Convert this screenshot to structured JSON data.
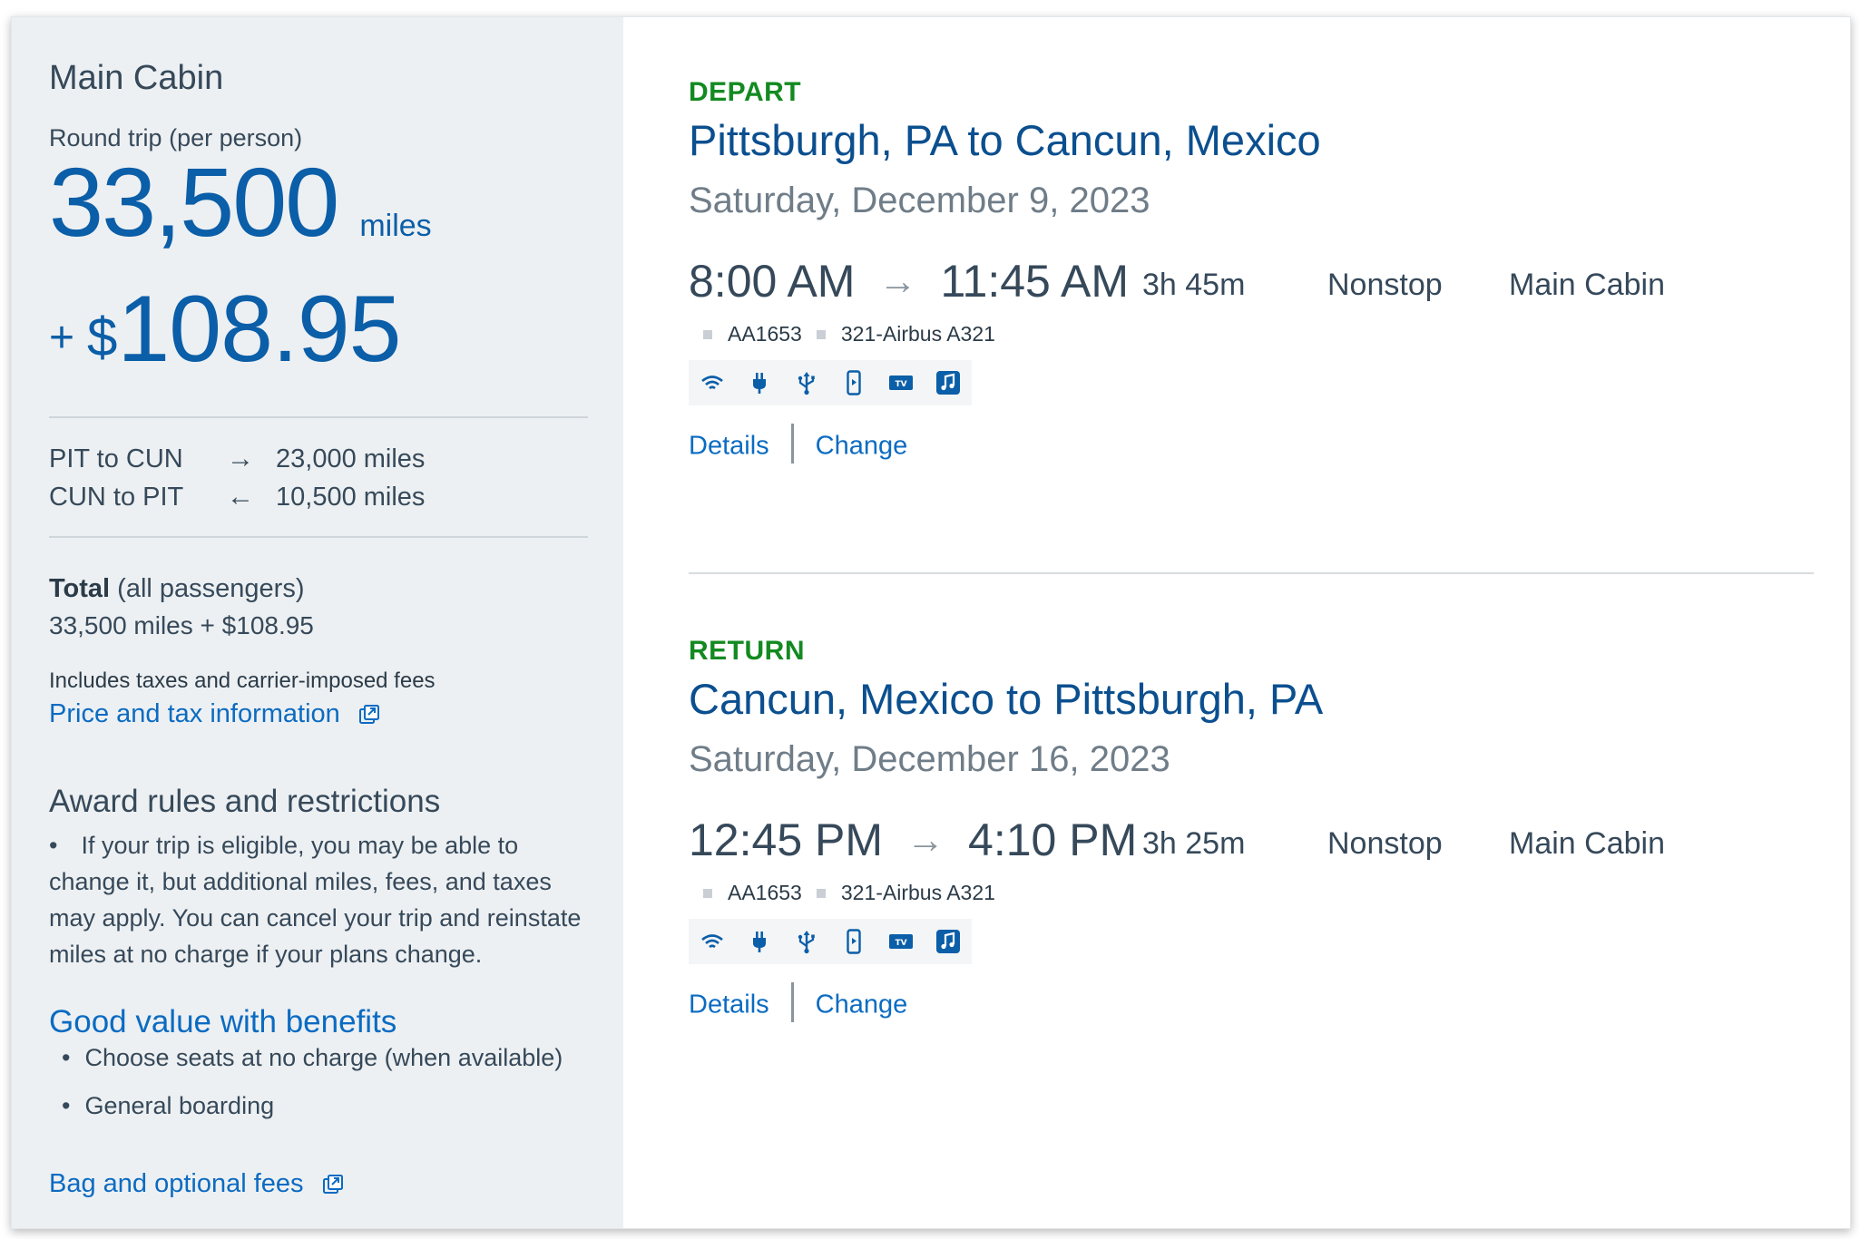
{
  "summary": {
    "cabin": "Main Cabin",
    "trip_type": "Round trip (per person)",
    "miles": "33,500",
    "miles_unit": "miles",
    "plus": "+",
    "currency": "$",
    "cash": "108.95",
    "segments": [
      {
        "route": "PIT to CUN",
        "arrow": "→",
        "miles": "23,000 miles"
      },
      {
        "route": "CUN to PIT",
        "arrow": "←",
        "miles": "10,500 miles"
      }
    ],
    "total_label": "Total",
    "total_sub": " (all passengers)",
    "total_value": "33,500 miles + $108.95",
    "tax_note": "Includes taxes and carrier-imposed fees",
    "tax_link": "Price and tax information",
    "rules_title": "Award rules and restrictions",
    "rules_bullet": "•",
    "rules_text": "If your trip is eligible, you may be able to change it, but additional miles, fees, and taxes may apply. You can cancel your trip and reinstate miles at no charge if your plans change.",
    "benefits_title": "Good value with benefits",
    "benefits": [
      "Choose seats at no charge (when available)",
      "General boarding"
    ],
    "bag_link": "Bag and optional fees"
  },
  "flights": [
    {
      "label": "DEPART",
      "route": "Pittsburgh, PA to Cancun, Mexico",
      "date": "Saturday, December 9, 2023",
      "depart": "8:00 AM",
      "arrow": "→",
      "arrive": "11:45 AM",
      "duration": "3h 45m",
      "stops": "Nonstop",
      "cabin": "Main Cabin",
      "flight_no": "AA1653",
      "aircraft": "321-Airbus A321",
      "amenities": [
        "wifi-icon",
        "power-outlet-icon",
        "usb-icon",
        "mobile-entertainment-icon",
        "tv-icon",
        "music-icon"
      ],
      "details": "Details",
      "change": "Change"
    },
    {
      "label": "RETURN",
      "route": "Cancun, Mexico to Pittsburgh, PA",
      "date": "Saturday, December 16, 2023",
      "depart": "12:45 PM",
      "arrow": "→",
      "arrive": "4:10 PM",
      "duration": "3h 25m",
      "stops": "Nonstop",
      "cabin": "Main Cabin",
      "flight_no": "AA1653",
      "aircraft": "321-Airbus A321",
      "amenities": [
        "wifi-icon",
        "power-outlet-icon",
        "usb-icon",
        "mobile-entertainment-icon",
        "tv-icon",
        "music-icon"
      ],
      "details": "Details",
      "change": "Change"
    }
  ],
  "colors": {
    "brand_blue": "#0b5ea8",
    "link_blue": "#0b6bc2",
    "leg_green": "#138a21",
    "panel_gray": "#edf0f2"
  }
}
